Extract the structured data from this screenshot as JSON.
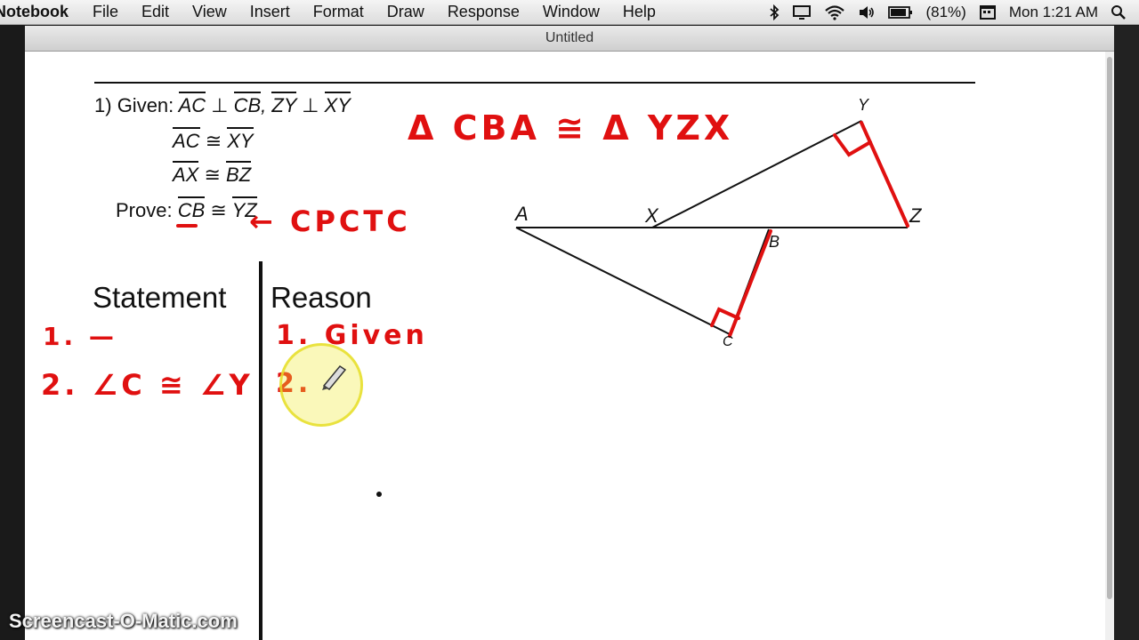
{
  "menubar": {
    "app_name": "Notebook",
    "items": [
      "File",
      "Edit",
      "View",
      "Insert",
      "Format",
      "Draw",
      "Response",
      "Window",
      "Help"
    ],
    "battery": "(81%)",
    "clock": "Mon 1:21 AM"
  },
  "window": {
    "title": "Untitled"
  },
  "problem": {
    "number": "1)",
    "given_label": "Given:",
    "given": [
      {
        "a": "AC",
        "rel": "⊥",
        "b": "CB",
        "sep": ",",
        "c": "ZY",
        "rel2": "⊥",
        "d": "XY"
      },
      {
        "a": "AC",
        "rel": "≅",
        "b": "XY"
      },
      {
        "a": "AX",
        "rel": "≅",
        "b": "BZ"
      }
    ],
    "prove_label": "Prove:",
    "prove": {
      "a": "CB",
      "rel": "≅",
      "b": "YZ"
    }
  },
  "annotations": {
    "congruence": "Δ CBA ≅ Δ YZX",
    "cpctc": "← CPCTC"
  },
  "diagram": {
    "points": {
      "A": "A",
      "X": "X",
      "Y": "Y",
      "Z": "Z",
      "B": "B",
      "C": "C"
    }
  },
  "proof": {
    "statement_header": "Statement",
    "reason_header": "Reason",
    "statements": [
      "1. —",
      "2. ∠C ≅ ∠Y"
    ],
    "reasons": [
      "1. Given",
      "2."
    ]
  },
  "watermark": "Screencast-O-Matic.com",
  "colors": {
    "ink": "#111111",
    "annotation": "#e01010",
    "cursor_highlight": "#f2ec3a"
  }
}
